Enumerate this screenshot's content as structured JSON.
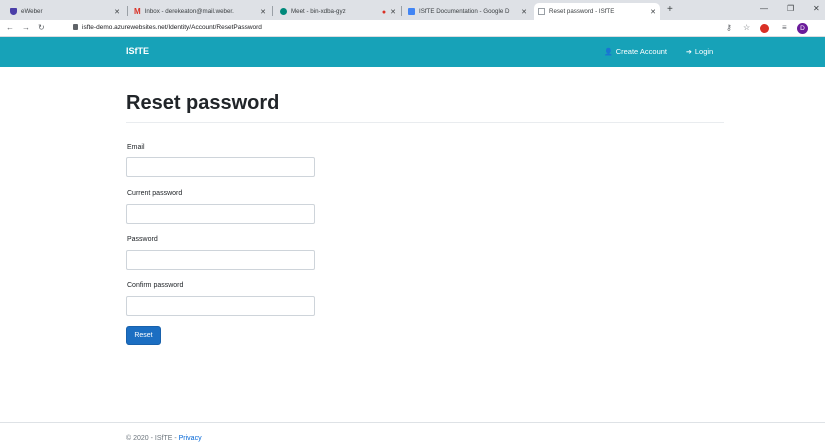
{
  "browser": {
    "tabs": [
      {
        "title": "eWeber",
        "icon": "shield-icon",
        "color": "#4a3ea8"
      },
      {
        "title": "Inbox - derekeaton@mail.weber.",
        "icon": "gmail-icon",
        "color": "#d93025"
      },
      {
        "title": "Meet - bin-xdba-gyz",
        "icon": "meet-icon",
        "color": "#00897b"
      },
      {
        "title": "ISfTE Documentation - Google D",
        "icon": "docs-icon",
        "color": "#4285f4"
      },
      {
        "title": "Reset password - ISfTE",
        "icon": "page-icon",
        "color": "#9aa0a6"
      }
    ],
    "url": "isfte-demo.azurewebsites.net/Identity/Account/ResetPassword",
    "profile_initial": "D",
    "colors": {
      "tabbar": "#dee1e6",
      "profile": "#6a1b9a"
    }
  },
  "navbar": {
    "brand": "ISfTE",
    "create_account": "Create Account",
    "login": "Login",
    "color": "#17a2b8"
  },
  "page": {
    "title": "Reset password",
    "fields": [
      {
        "label": "Email",
        "value": ""
      },
      {
        "label": "Current password",
        "value": ""
      },
      {
        "label": "Password",
        "value": ""
      },
      {
        "label": "Confirm password",
        "value": ""
      }
    ],
    "submit_label": "Reset",
    "submit_color": "#1b6ec2"
  },
  "footer": {
    "copyright": "© 2020 - ISfTE - ",
    "privacy": "Privacy"
  }
}
